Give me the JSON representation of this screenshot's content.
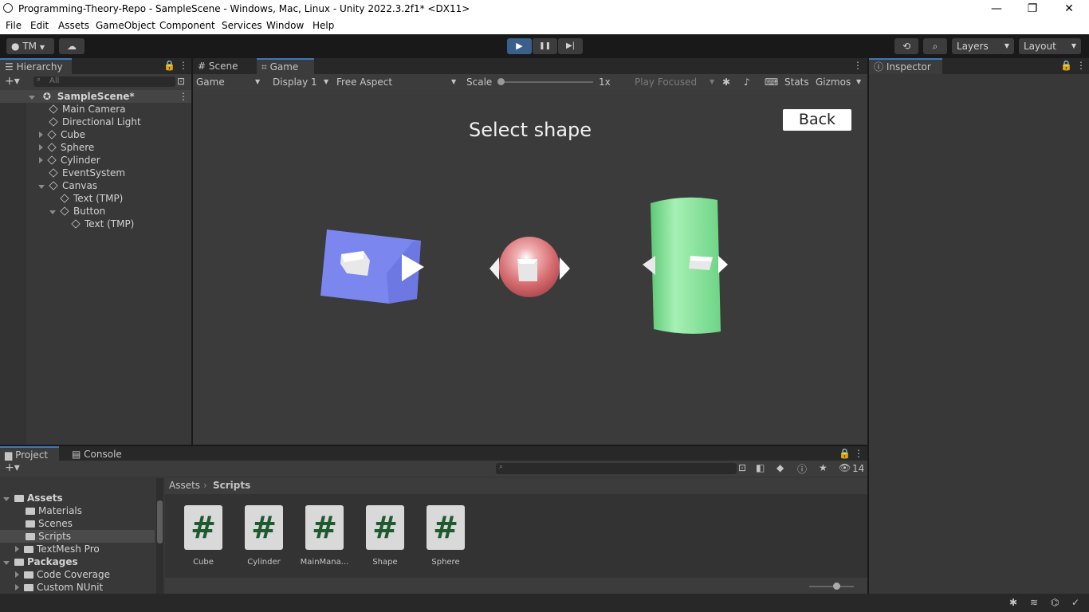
{
  "window": {
    "title": "Programming-Theory-Repo - SampleScene - Windows, Mac, Linux - Unity 2022.3.2f1* <DX11>",
    "minimize_glyph": "—",
    "restore_glyph": "❐",
    "close_glyph": "✕"
  },
  "menu": [
    "File",
    "Edit",
    "Assets",
    "GameObject",
    "Component",
    "Services",
    "Window",
    "Help"
  ],
  "toolbar": {
    "account": "TM",
    "play_glyph": "▶",
    "pause_glyph": "❚❚",
    "step_glyph": "▶|",
    "layers": "Layers",
    "layout": "Layout"
  },
  "hierarchy": {
    "tab": "Hierarchy",
    "search_placeholder": "All",
    "scene": "SampleScene*",
    "items": [
      "Main Camera",
      "Directional Light",
      "Cube",
      "Sphere",
      "Cylinder",
      "EventSystem",
      "Canvas",
      "Text (TMP)",
      "Button",
      "Text (TMP)"
    ]
  },
  "game_view": {
    "tabs": [
      "Scene",
      "Game"
    ],
    "mode": "Game",
    "display": "Display 1",
    "aspect": "Free Aspect",
    "scale_label": "Scale",
    "scale_value": "1x",
    "play_focused": "Play Focused",
    "stats": "Stats",
    "gizmos": "Gizmos",
    "heading": "Select shape",
    "back_button": "Back",
    "colors": {
      "cube": "#7b86ef",
      "sphere": "#d97b7e",
      "cylinder": "#86e59a",
      "background": "#3b3b3b"
    }
  },
  "inspector": {
    "tab": "Inspector"
  },
  "project": {
    "tabs": [
      "Project",
      "Console"
    ],
    "tree": {
      "assets": "Assets",
      "asset_children": [
        "Materials",
        "Scenes",
        "Scripts",
        "TextMesh Pro"
      ],
      "packages": "Packages",
      "package_children": [
        "Code Coverage",
        "Custom NUnit"
      ]
    },
    "breadcrumb": [
      "Assets",
      "Scripts"
    ],
    "hidden_count": "14",
    "scripts": [
      "Cube",
      "Cylinder",
      "MainMana...",
      "Shape",
      "Sphere"
    ],
    "script_glyph": "#"
  }
}
